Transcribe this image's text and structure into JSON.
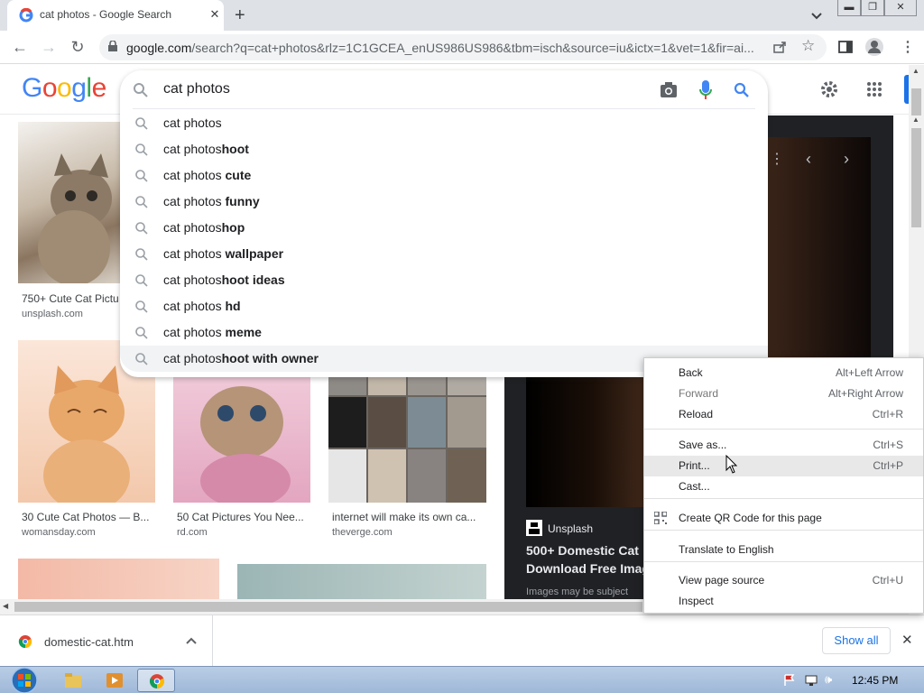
{
  "browser": {
    "tab_title": "cat photos - Google Search",
    "new_tab_label": "+",
    "url_host": "google.com",
    "url_rest": "/search?q=cat+photos&rlz=1C1GCEA_enUS986US986&tbm=isch&source=iu&ictx=1&vet=1&fir=ai..."
  },
  "google": {
    "logo_letters": [
      "G",
      "o",
      "o",
      "g",
      "l",
      "e"
    ],
    "logo_colors": [
      "#4285f4",
      "#ea4335",
      "#fbbc05",
      "#4285f4",
      "#34a853",
      "#ea4335"
    ],
    "search_value": "cat photos",
    "suggestions": [
      {
        "prefix": "cat photos",
        "rest": ""
      },
      {
        "prefix": "cat photos",
        "rest": "hoot"
      },
      {
        "prefix": "cat photos ",
        "rest": "cute"
      },
      {
        "prefix": "cat photos ",
        "rest": "funny"
      },
      {
        "prefix": "cat photos",
        "rest": "hop"
      },
      {
        "prefix": "cat photos ",
        "rest": "wallpaper"
      },
      {
        "prefix": "cat photos",
        "rest": "hoot ideas"
      },
      {
        "prefix": "cat photos ",
        "rest": "hd"
      },
      {
        "prefix": "cat photos ",
        "rest": "meme"
      },
      {
        "prefix": "cat photos",
        "rest": "hoot with owner"
      }
    ]
  },
  "results": [
    {
      "caption": "750+ Cute Cat Pictu",
      "domain": "unsplash.com"
    },
    {
      "caption": "30 Cute Cat Photos — B...",
      "domain": "womansday.com"
    },
    {
      "caption": "50 Cat Pictures You Nee...",
      "domain": "rd.com"
    },
    {
      "caption": "internet will make its own ca...",
      "domain": "theverge.com"
    }
  ],
  "preview": {
    "source": "Unsplash",
    "title_line1": "500+ Domestic Cat",
    "title_line2": "Download Free Imag",
    "note": "Images may be subject"
  },
  "context_menu": {
    "items": [
      {
        "label": "Back",
        "shortcut": "Alt+Left Arrow",
        "disabled": false
      },
      {
        "label": "Forward",
        "shortcut": "Alt+Right Arrow",
        "disabled": true
      },
      {
        "label": "Reload",
        "shortcut": "Ctrl+R",
        "disabled": false
      },
      {
        "label": "Save as...",
        "shortcut": "Ctrl+S",
        "disabled": false
      },
      {
        "label": "Print...",
        "shortcut": "Ctrl+P",
        "disabled": false
      },
      {
        "label": "Cast...",
        "shortcut": "",
        "disabled": false
      },
      {
        "label": "Create QR Code for this page",
        "shortcut": "",
        "disabled": false
      },
      {
        "label": "Translate to English",
        "shortcut": "",
        "disabled": false
      },
      {
        "label": "View page source",
        "shortcut": "Ctrl+U",
        "disabled": false
      },
      {
        "label": "Inspect",
        "shortcut": "",
        "disabled": false
      }
    ]
  },
  "download": {
    "file_name": "domestic-cat.htm",
    "show_all_label": "Show all"
  },
  "taskbar": {
    "clock": "12:45 PM"
  }
}
